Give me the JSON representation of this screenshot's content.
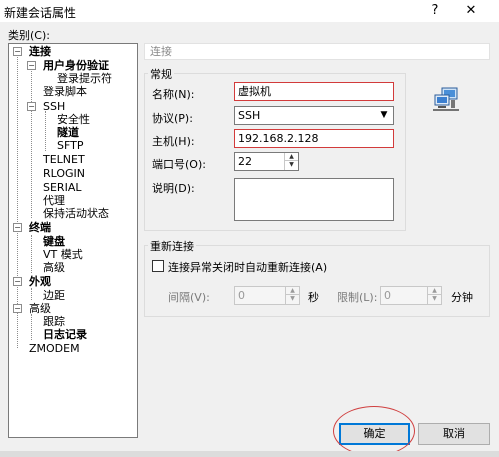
{
  "window": {
    "title": "新建会话属性",
    "help_glyph": "?",
    "close_glyph": "✕"
  },
  "category_label": "类别(C):",
  "tree": {
    "items": [
      {
        "label": "连接",
        "bold": true,
        "toggle": "−"
      },
      {
        "label": "用户身份验证",
        "bold": true,
        "toggle": "−"
      },
      {
        "label": "登录提示符",
        "bold": false
      },
      {
        "label": "登录脚本",
        "bold": false
      },
      {
        "label": "SSH",
        "bold": false,
        "toggle": "−"
      },
      {
        "label": "安全性",
        "bold": false
      },
      {
        "label": "隧道",
        "bold": true
      },
      {
        "label": "SFTP",
        "bold": false
      },
      {
        "label": "TELNET",
        "bold": false
      },
      {
        "label": "RLOGIN",
        "bold": false
      },
      {
        "label": "SERIAL",
        "bold": false
      },
      {
        "label": "代理",
        "bold": false
      },
      {
        "label": "保持活动状态",
        "bold": false
      },
      {
        "label": "终端",
        "bold": true,
        "toggle": "−"
      },
      {
        "label": "键盘",
        "bold": true
      },
      {
        "label": "VT 模式",
        "bold": false
      },
      {
        "label": "高级",
        "bold": false
      },
      {
        "label": "外观",
        "bold": true,
        "toggle": "−"
      },
      {
        "label": "边距",
        "bold": false
      },
      {
        "label": "高级",
        "bold": false,
        "toggle": "−"
      },
      {
        "label": "跟踪",
        "bold": false
      },
      {
        "label": "日志记录",
        "bold": true
      },
      {
        "label": "ZMODEM",
        "bold": false
      }
    ]
  },
  "section_header": "连接",
  "general": {
    "title": "常规",
    "name_label": "名称(N):",
    "name_value": "虚拟机",
    "protocol_label": "协议(P):",
    "protocol_value": "SSH",
    "host_label": "主机(H):",
    "host_value": "192.168.2.128",
    "port_label": "端口号(O):",
    "port_value": "22",
    "desc_label": "说明(D):",
    "desc_value": ""
  },
  "reconnect": {
    "title": "重新连接",
    "checkbox_label": "连接异常关闭时自动重新连接(A)",
    "checked": false,
    "interval_label": "间隔(V):",
    "interval_value": "0",
    "interval_unit": "秒",
    "limit_label": "限制(L):",
    "limit_value": "0",
    "limit_unit": "分钟"
  },
  "buttons": {
    "ok": "确定",
    "cancel": "取消"
  },
  "icons": {
    "network_icon": "network-computers-icon"
  },
  "colors": {
    "highlight_red": "#d23b3b",
    "primary_blue": "#0078d7"
  }
}
